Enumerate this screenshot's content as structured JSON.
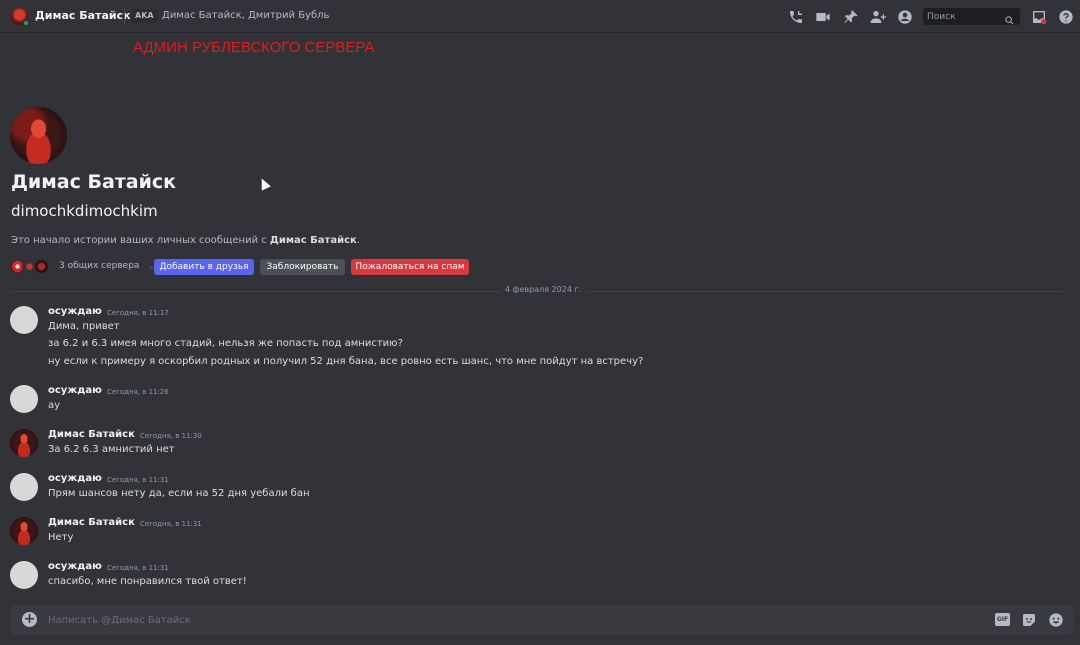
{
  "header": {
    "title": "Димас Батайск",
    "aka_badge": "AKA",
    "aka_names": "Димас Батайск, Дмитрий Бубль",
    "search_placeholder": "Поиск",
    "icons": [
      "phone-call-icon",
      "video-call-icon",
      "pin-icon",
      "add-friend-to-dm-icon",
      "user-profile-icon",
      "inbox-icon",
      "help-icon"
    ]
  },
  "caption": "АДМИН РУБЛЕВСКОГО СЕРВЕРА",
  "profile": {
    "display_name": "Димас Батайск",
    "username": "dimochkdimochkim",
    "intro_prefix": "Это начало истории ваших личных сообщений с ",
    "intro_name": "Димас Батайск",
    "intro_suffix": ".",
    "mutual_servers": "3 общих сервера",
    "add_friend_label": "Добавить в друзья",
    "block_label": "Заблокировать",
    "report_label": "Пожаловаться на спам"
  },
  "date_divider": "4 февраля 2024 г.",
  "messages": [
    {
      "author": "осуждаю",
      "time": "Сегодня, в 11:17",
      "lines": [
        "Дима, привет",
        "за 6.2 и 6.3 имея много стадий, нельзя же попасть под амнистию?",
        "ну если к примеру я оскорбил родных и получил 52 дня бана, все ровно есть шанс, что мне пойдут на встречу?"
      ]
    },
    {
      "author": "осуждаю",
      "time": "Сегодня, в 11:26",
      "lines": [
        "ау"
      ]
    },
    {
      "author": "Димас Батайск",
      "time": "Сегодня, в 11:30",
      "lines": [
        "За 6.2 6.3 амнистий нет"
      ]
    },
    {
      "author": "осуждаю",
      "time": "Сегодня, в 11:31",
      "lines": [
        "Прям шансов нету да, если на 52 дня уебали бан"
      ]
    },
    {
      "author": "Димас Батайск",
      "time": "Сегодня, в 11:31",
      "lines": [
        "Нету"
      ]
    },
    {
      "author": "осуждаю",
      "time": "Сегодня, в 11:31",
      "lines": [
        "спасибо, мне понравился твой ответ!"
      ]
    }
  ],
  "composer": {
    "placeholder": "Написать @Димас Батайск",
    "gif_label": "GIF"
  },
  "colors": {
    "background": "#313338",
    "blurple": "#5865f2",
    "danger": "#da373c",
    "caption_red": "#e21b1b"
  }
}
